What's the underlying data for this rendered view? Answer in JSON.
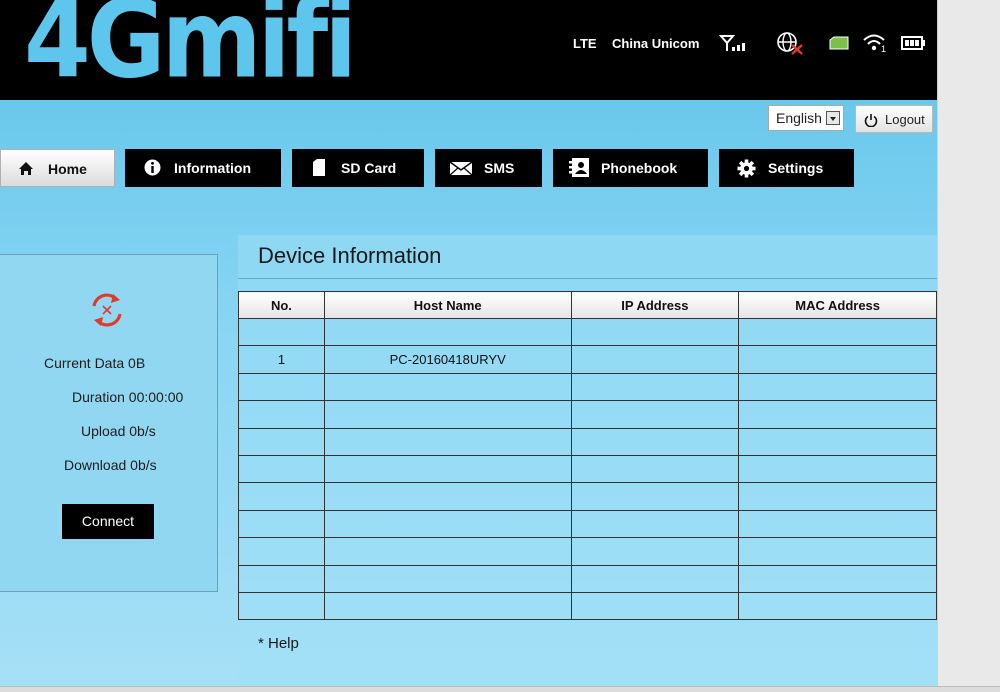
{
  "header": {
    "logo_text": "4Gmifi",
    "network_type": "LTE",
    "operator": "China Unicom",
    "icons": [
      "signal-icon",
      "internet-disconnected-icon",
      "sim-icon",
      "wifi-icon",
      "battery-icon"
    ],
    "wifi_clients": "1"
  },
  "toolbar": {
    "language_value": "English",
    "logout_label": "Logout"
  },
  "nav": {
    "items": [
      {
        "label": "Home",
        "icon": "home-icon"
      },
      {
        "label": "Information",
        "icon": "info-icon"
      },
      {
        "label": "SD Card",
        "icon": "sd-card-icon"
      },
      {
        "label": "SMS",
        "icon": "envelope-icon"
      },
      {
        "label": "Phonebook",
        "icon": "phonebook-icon"
      },
      {
        "label": "Settings",
        "icon": "gear-icon"
      }
    ],
    "active": "Home"
  },
  "connection": {
    "current_data": "Current Data 0B",
    "duration": "Duration 00:00:00",
    "upload": "Upload 0b/s",
    "download": "Download 0b/s",
    "connect_label": "Connect",
    "status_icon": "disconnected-refresh-icon"
  },
  "device_info": {
    "title": "Device Information",
    "columns": [
      "No.",
      "Host Name",
      "IP Address",
      "MAC Address"
    ],
    "rows": [
      [
        "",
        "",
        "",
        ""
      ],
      [
        "1",
        "PC-20160418URYV",
        "",
        ""
      ],
      [
        "",
        "",
        "",
        ""
      ],
      [
        "",
        "",
        "",
        ""
      ],
      [
        "",
        "",
        "",
        ""
      ],
      [
        "",
        "",
        "",
        ""
      ],
      [
        "",
        "",
        "",
        ""
      ],
      [
        "",
        "",
        "",
        ""
      ],
      [
        "",
        "",
        "",
        ""
      ],
      [
        "",
        "",
        "",
        ""
      ],
      [
        "",
        "",
        "",
        ""
      ]
    ],
    "help": "* Help"
  },
  "colors": {
    "brand": "#5ec6ec",
    "header_bg": "#000000",
    "main_bg": "#8ad6f3",
    "alert_red": "#e03a2a"
  }
}
